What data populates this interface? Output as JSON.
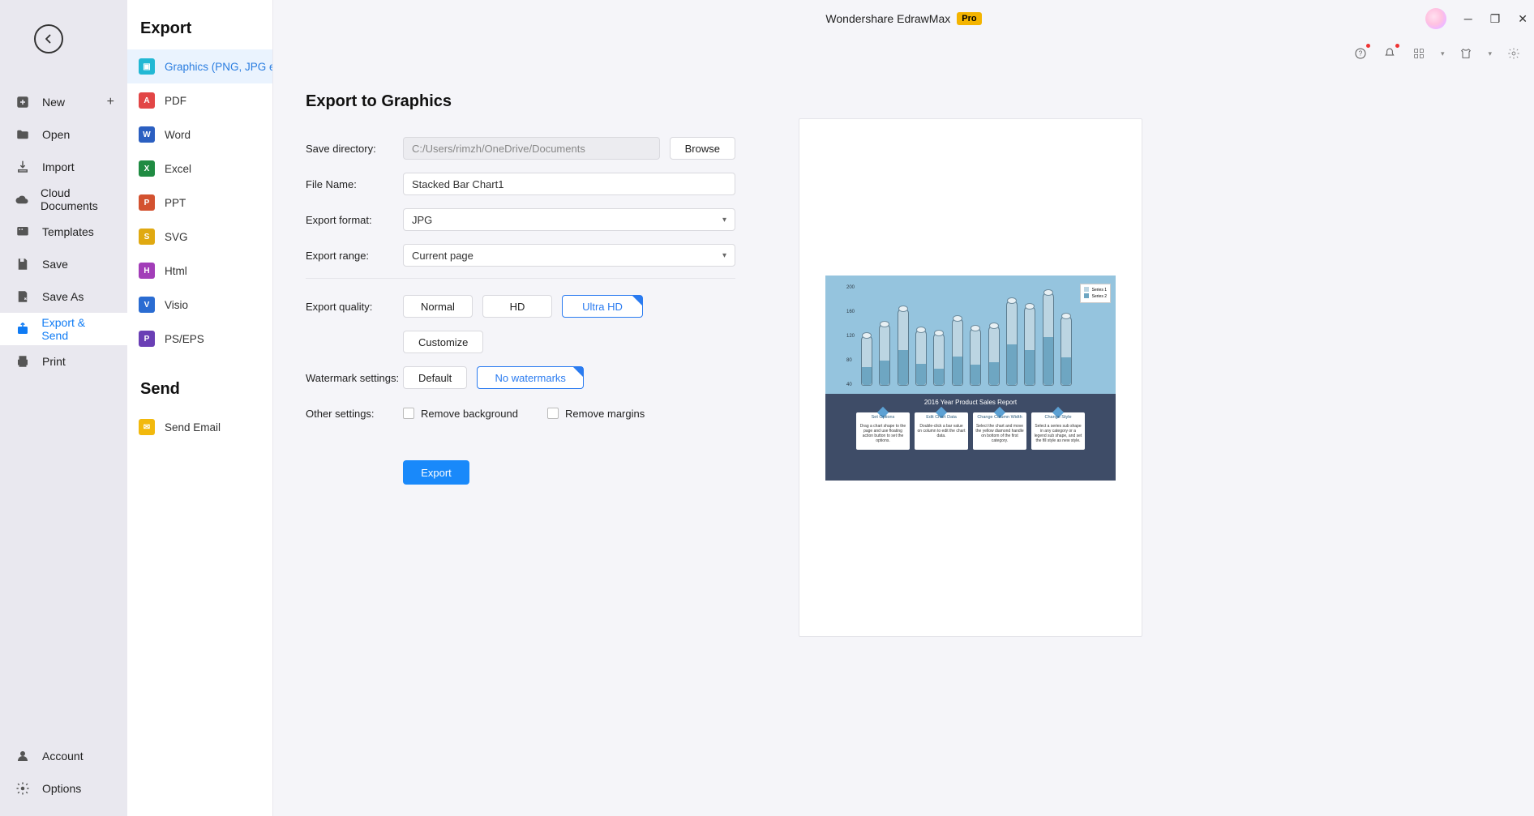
{
  "titlebar": {
    "app": "Wondershare EdrawMax",
    "badge": "Pro"
  },
  "nav": {
    "items": [
      {
        "label": "New"
      },
      {
        "label": "Open"
      },
      {
        "label": "Import"
      },
      {
        "label": "Cloud Documents"
      },
      {
        "label": "Templates"
      },
      {
        "label": "Save"
      },
      {
        "label": "Save As"
      },
      {
        "label": "Export & Send"
      },
      {
        "label": "Print"
      }
    ],
    "account": "Account",
    "options": "Options"
  },
  "exportPanel": {
    "heading": "Export",
    "formats": [
      {
        "label": "Graphics (PNG, JPG et..."
      },
      {
        "label": "PDF"
      },
      {
        "label": "Word"
      },
      {
        "label": "Excel"
      },
      {
        "label": "PPT"
      },
      {
        "label": "SVG"
      },
      {
        "label": "Html"
      },
      {
        "label": "Visio"
      },
      {
        "label": "PS/EPS"
      }
    ],
    "sendHeading": "Send",
    "sendEmail": "Send Email"
  },
  "form": {
    "title": "Export to Graphics",
    "labels": {
      "saveDir": "Save directory:",
      "fileName": "File Name:",
      "format": "Export format:",
      "range": "Export range:",
      "quality": "Export quality:",
      "watermark": "Watermark settings:",
      "other": "Other settings:"
    },
    "saveDir": "C:/Users/rimzh/OneDrive/Documents",
    "browse": "Browse",
    "fileName": "Stacked Bar Chart1",
    "format": "JPG",
    "range": "Current page",
    "quality": {
      "normal": "Normal",
      "hd": "HD",
      "uhd": "Ultra HD",
      "customize": "Customize"
    },
    "watermark": {
      "default": "Default",
      "none": "No watermarks"
    },
    "removeBg": "Remove background",
    "removeMargins": "Remove margins",
    "export": "Export"
  },
  "preview": {
    "title": "2016 Year Product Sales Report",
    "legend": {
      "s1": "Series 1",
      "s2": "Series 2"
    },
    "axis": [
      "200",
      "160",
      "120",
      "80",
      "40"
    ],
    "cards": [
      {
        "t": "Set Options",
        "b": "Drag a chart shape to the page and use floating action button to set the options."
      },
      {
        "t": "Edit Chart Data",
        "b": "Double-click a bar value on column to edit the chart data."
      },
      {
        "t": "Change Column Width",
        "b": "Select the chart and move the yellow diamond handle on bottom of the first category."
      },
      {
        "t": "Change Style",
        "b": "Select a series sub shape in any category or a legend sub shape, and set the fill style as new style."
      }
    ]
  }
}
